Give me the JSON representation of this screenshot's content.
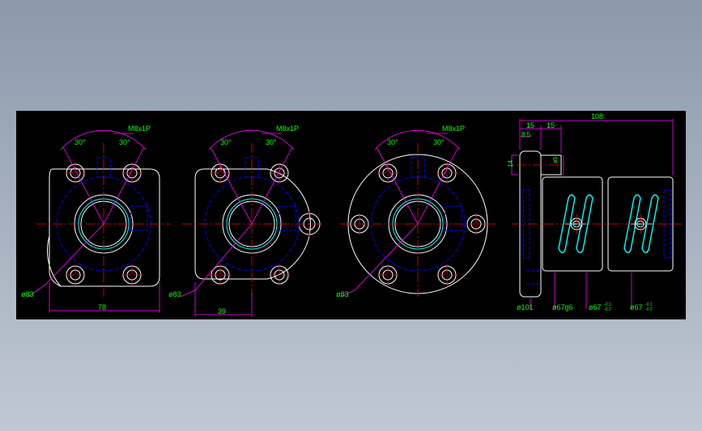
{
  "colors": {
    "background": "#000000",
    "outline": "#ffffff",
    "centerline": "#ff0000",
    "hidden": "#0000ff",
    "dimension": "#ff00ff",
    "text": "#00ff00",
    "thread": "#00ffff"
  },
  "views": [
    {
      "name": "flange-two-flats",
      "angle_left": "30°",
      "angle_right": "30°",
      "thread_note": "M8x1P",
      "dia_label": "ø83",
      "width_dim": "78"
    },
    {
      "name": "flange-one-flat",
      "angle_left": "30°",
      "angle_right": "30°",
      "thread_note": "M8x1P",
      "dia_label": "ø83",
      "width_dim": "39"
    },
    {
      "name": "flange-round",
      "angle_left": "30°",
      "angle_right": "30°",
      "thread_note": "M8x1P",
      "dia_label": "ø83"
    }
  ],
  "side_view": {
    "overall_length": "108",
    "flange_dim1": "15",
    "flange_dim2": "15",
    "offset_dim": "8.5",
    "height_dim": "14",
    "small_dia": "ø5",
    "bottom_labels": [
      "ø101",
      "ø67g6",
      "ø67",
      "ø67"
    ],
    "tol_upper": "-0.1",
    "tol_lower": "-0.2"
  }
}
